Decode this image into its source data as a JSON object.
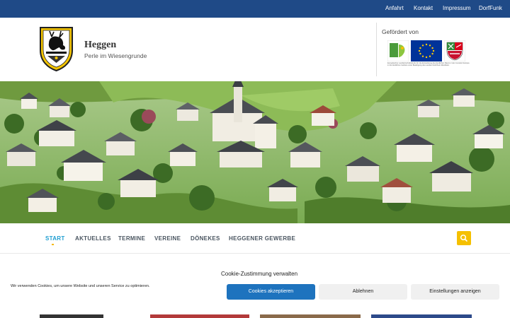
{
  "topnav": {
    "items": [
      "Anfahrt",
      "Kontakt",
      "Impressum",
      "DorfFunk"
    ]
  },
  "site": {
    "title": "Heggen",
    "tagline": "Perle im Wiesengrunde"
  },
  "funding": {
    "label": "Gefördert von",
    "fineprint": "Europäischer Landwirtschaftsfonds für die Entwicklung des ländlichen Raums: Hier investiert Europa in die ländlichen Gebiete unter Beteiligung des Landes Nordrhein-Westfalen"
  },
  "mainnav": {
    "items": [
      "START",
      "AKTUELLES",
      "TERMINE",
      "VEREINE",
      "DÖNEKES",
      "HEGGENER GEWERBE"
    ],
    "active": "START"
  },
  "cookie": {
    "title": "Cookie-Zustimmung verwalten",
    "text": "Wir verwenden Cookies, um unsere Website und unseren Service zu optimieren.",
    "accept": "Cookies akzeptieren",
    "decline": "Ablehnen",
    "settings": "Einstellungen anzeigen"
  },
  "colors": {
    "topbar": "#1f4a87",
    "accent": "#1f9ed1",
    "search": "#f5c000",
    "cookie_primary": "#1e73be"
  },
  "icons": [
    "heggen-crest-icon",
    "leader-logo-icon",
    "eu-flag-icon",
    "nrw-logo-icon",
    "search-icon"
  ]
}
